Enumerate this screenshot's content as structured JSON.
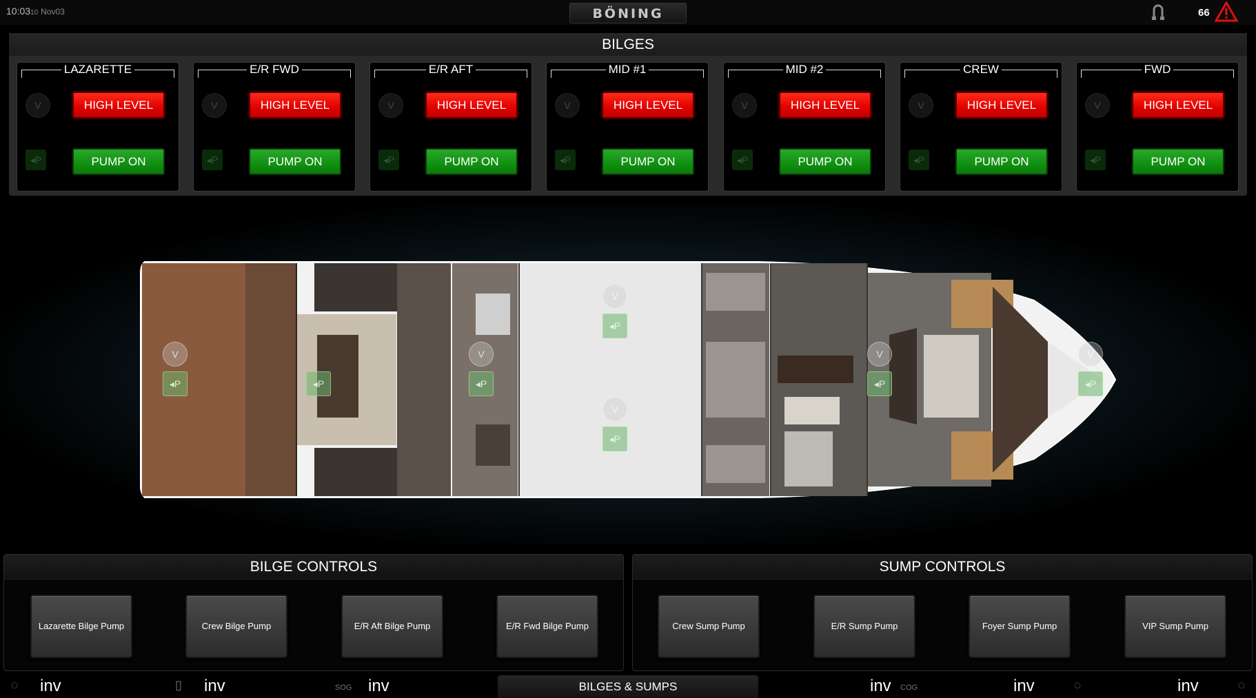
{
  "topbar": {
    "time": "10:03",
    "seconds": "10",
    "date": "Nov03",
    "brand": "BÖNING",
    "alarm_count": "66",
    "icons": [
      "anchor-icon",
      "alarm-warning-icon"
    ]
  },
  "bilges": {
    "title": "BILGES",
    "zones": [
      {
        "name": "LAZARETTE",
        "alarm": "HIGH LEVEL",
        "pump": "PUMP ON"
      },
      {
        "name": "E/R FWD",
        "alarm": "HIGH LEVEL",
        "pump": "PUMP ON"
      },
      {
        "name": "E/R AFT",
        "alarm": "HIGH LEVEL",
        "pump": "PUMP ON"
      },
      {
        "name": "MID #1",
        "alarm": "HIGH LEVEL",
        "pump": "PUMP ON"
      },
      {
        "name": "MID #2",
        "alarm": "HIGH LEVEL",
        "pump": "PUMP ON"
      },
      {
        "name": "CREW",
        "alarm": "HIGH LEVEL",
        "pump": "PUMP ON"
      },
      {
        "name": "FWD",
        "alarm": "HIGH LEVEL",
        "pump": "PUMP ON"
      }
    ],
    "colors": {
      "alarm": "#e00000",
      "pump": "#109010"
    }
  },
  "bilge_controls": {
    "title": "BILGE CONTROLS",
    "buttons": [
      "Lazarette Bilge Pump",
      "Crew Bilge Pump",
      "E/R Aft Bilge Pump",
      "E/R Fwd Bilge Pump"
    ]
  },
  "sump_controls": {
    "title": "SUMP CONTROLS",
    "buttons": [
      "Crew Sump Pump",
      "E/R Sump Pump",
      "Foyer Sump Pump",
      "VIP Sump Pump"
    ]
  },
  "bottombar": {
    "values": [
      "inv",
      "inv",
      "inv",
      "inv",
      "inv",
      "inv"
    ],
    "sog_label": "SOG",
    "cog_label": "COG",
    "center_label": "BILGES & SUMPS"
  }
}
